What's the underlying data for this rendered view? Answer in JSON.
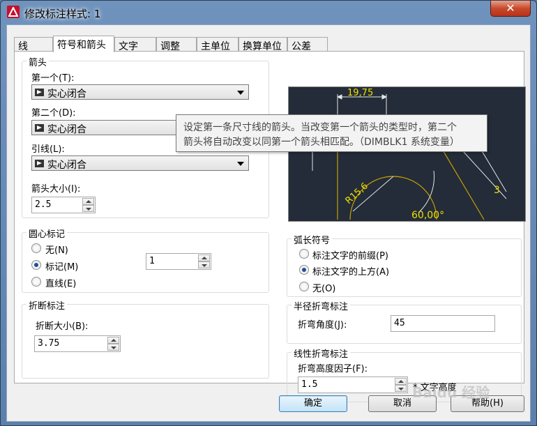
{
  "window": {
    "title": "修改标注样式: 1",
    "close_label": "✕"
  },
  "tabs": [
    {
      "label": "线"
    },
    {
      "label": "符号和箭头"
    },
    {
      "label": "文字"
    },
    {
      "label": "调整"
    },
    {
      "label": "主单位"
    },
    {
      "label": "换算单位"
    },
    {
      "label": "公差"
    }
  ],
  "arrowheads": {
    "group_title": "箭头",
    "first_label": "第一个(T):",
    "first_value": "实心闭合",
    "second_label": "第二个(D):",
    "second_value": "实心闭合",
    "leader_label": "引线(L):",
    "leader_value": "实心闭合",
    "size_label": "箭头大小(I):",
    "size_value": "2.5"
  },
  "center_marks": {
    "group_title": "圆心标记",
    "options": [
      {
        "label": "无(N)",
        "checked": false
      },
      {
        "label": "标记(M)",
        "checked": true
      },
      {
        "label": "直线(E)",
        "checked": false
      }
    ],
    "size_value": "1"
  },
  "dim_break": {
    "group_title": "折断标注",
    "size_label": "折断大小(B):",
    "size_value": "3.75"
  },
  "preview": {
    "dim_top": "19,75",
    "dim_radius": "R15,6",
    "dim_angle": "60,00°",
    "dim_side": "3"
  },
  "arc_length": {
    "group_title": "弧长符号",
    "options": [
      {
        "label": "标注文字的前缀(P)",
        "checked": false
      },
      {
        "label": "标注文字的上方(A)",
        "checked": true
      },
      {
        "label": "无(O)",
        "checked": false
      }
    ]
  },
  "radius_jog": {
    "group_title": "半径折弯标注",
    "angle_label": "折弯角度(J):",
    "angle_value": "45"
  },
  "linear_jog": {
    "group_title": "线性折弯标注",
    "factor_label": "折弯高度因子(F):",
    "factor_value": "1.5",
    "suffix": "* 文字高度"
  },
  "tooltip": {
    "line1": "设定第一条尺寸线的箭头。当改变第一个箭头的类型时，第二个",
    "line2": "箭头将自动改变以同第一个箭头相匹配。（DIMBLK1 系统变量）"
  },
  "buttons": {
    "ok": "确定",
    "cancel": "取消",
    "help": "帮助(H)"
  },
  "watermark": "Baidu 经验"
}
